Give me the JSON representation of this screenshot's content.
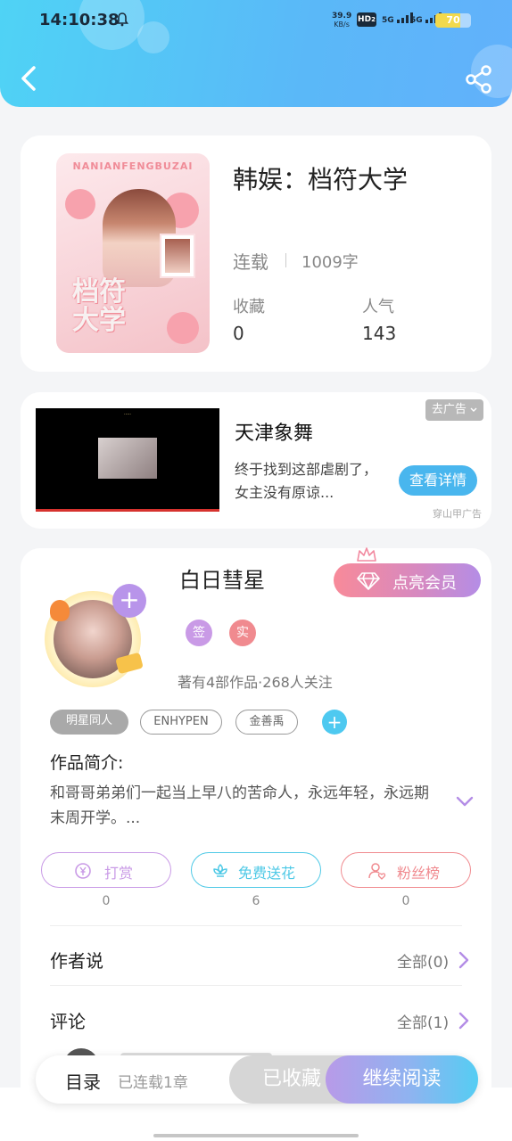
{
  "status_bar": {
    "time": "14:10:38",
    "net_speed_value": "39.9",
    "net_speed_unit": "KB/s",
    "hd_label": "HD",
    "hd_sub": "2",
    "sig1": "5G",
    "sig2": "5G",
    "battery": "70",
    "battery_level": 0.7
  },
  "book": {
    "title": "韩娱：档符大学",
    "status": "连载",
    "word_count": "1009字",
    "stats": [
      {
        "label": "收藏",
        "value": "0"
      },
      {
        "label": "人气",
        "value": "143"
      }
    ],
    "cover": {
      "top_text": "NANIANFENGBUZAI",
      "title_text": "档符\n大学"
    }
  },
  "ad": {
    "title": "天津象舞",
    "description": "终于找到这部虐剧了，女主没有原谅...",
    "cta": "查看详情",
    "close_label": "去广告",
    "source": "穿山甲广告"
  },
  "author": {
    "name": "白日彗星",
    "vip_button": "点亮会员",
    "badges": [
      {
        "label": "签",
        "color": "#c99ae6"
      },
      {
        "label": "实",
        "color": "#f08a8f"
      }
    ],
    "meta": "著有4部作品·268人关注",
    "tags": [
      "明星同人",
      "ENHYPEN",
      "金善禹"
    ],
    "intro_label": "作品简介:",
    "intro_text": "和哥哥弟弟们一起当上早八的苦命人，永远年轻，永远期末周开学。...",
    "actions": [
      {
        "label": "打赏",
        "count": "0",
        "color": "#c99ae6"
      },
      {
        "label": "免费送花",
        "count": "6",
        "color": "#4ec9e6"
      },
      {
        "label": "粉丝榜",
        "count": "0",
        "color": "#f08a8f"
      }
    ]
  },
  "sections": {
    "author_says": {
      "label": "作者说",
      "more": "全部(0)"
    },
    "comments": {
      "label": "评论",
      "more": "全部(1)"
    }
  },
  "bottom_bar": {
    "toc_label": "目录",
    "toc_sub": "已连载1章",
    "favorite": "已收藏",
    "continue": "继续阅读"
  },
  "colors": {
    "header_start": "#4fd3f5",
    "header_end": "#62b1fb",
    "accent_blue": "#49b6ee",
    "vip_start": "#f88a99",
    "vip_end": "#b48de6"
  }
}
